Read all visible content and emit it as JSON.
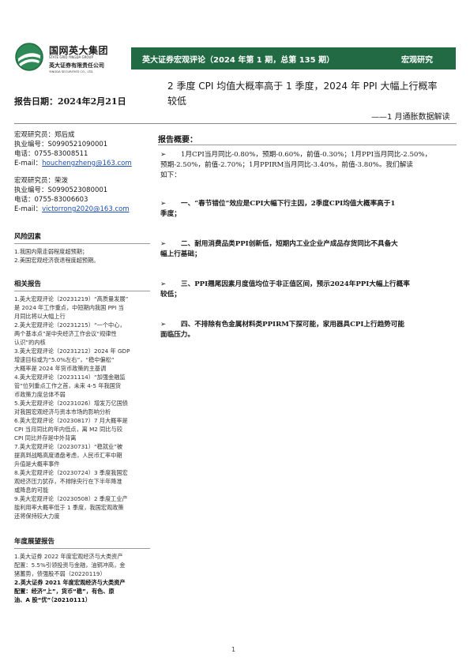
{
  "header": {
    "logo_cn": "国网英大集团",
    "logo_en": "STATE GRID YINGDA GROUP",
    "logo_sub": "英大证券有限责任公司",
    "logo_sub_en": "YINGDA SECURITIES CO., LTD.",
    "band_title": "英大证券宏观评论（2024 年第 1 期，总第 135 期）",
    "band_right": "宏观研究",
    "band_color": "#216a43"
  },
  "title": {
    "line1": "2 季度 CPI 均值大概率高于 1 季度，2024 年 PPI 大幅上行概率",
    "line2": "较低",
    "subtitle": "——1 月通胀数据解读"
  },
  "report_date": "报告日期：2024年2月21日",
  "analysts": [
    {
      "name": "宏观研究员：郑后成",
      "cert": "执业编号：S0990521090001",
      "phone": "电话：0755-83008511",
      "email_label": "E-mail：",
      "email": "houchengzheng@163.com"
    },
    {
      "name": "宏观研究员：荣泼",
      "cert": "执业编号：S0990523080001",
      "phone": "电话：0755-83006603",
      "email_label": "E-mail：",
      "email": "victorrong2020@163.com"
    }
  ],
  "risk": {
    "title": "风险因素",
    "items": [
      "1.我国内需走弱程度超预期；",
      "2.美国宏观经济衰退程度超预期。"
    ]
  },
  "related": {
    "title": "相关报告",
    "items": [
      "1.英大宏观评论（20231219）“高质量发展”",
      "是 2024 年工作重点，中短期内我国 PPI 当",
      "月同比将以大幅上行",
      "2.英大宏观评论（20231215）“一个中心，",
      "两个基本点”是中央经济工作会议“规律性",
      "认识”的内核",
      "3.英大宏观评论（20231212）2024 年 GDP",
      "增速目标或为“5.0%左右”，“稳中偏松”",
      "大概率是 2024 年货币政策的主基调",
      "4.英大宏观评论（20231114）“加强金融监",
      "管”位列重点工作之首，未来 4-5 年我国货",
      "币政策力度总体不弱",
      "5.英大宏观评论（20231026）增发万亿国债",
      "对我国宏观经济与资本市场的影响分析",
      "6.英大宏观评论（20230817）7 月大概率是",
      "CPI 当月同比的年内低点，离 M2 同比与较",
      "CPI 同比并存是中外背离",
      "7.英大宏观评论（20230731）“稳就业”被",
      "提高到战略高度通盘考虑，人民币汇率中期",
      "升值是大概率事件",
      "8.英大宏观评论（20230724）3 季度我国宏",
      "观经济压力犹存，不排除央行在下半年降准",
      "或降息的可能",
      "9.英大宏观评论（20230508）2 季度工业产",
      "能利用率大概率低于 1 季度，我国宏观政策",
      "还将保持较大力度"
    ]
  },
  "annual": {
    "title": "年度展望报告",
    "items": [
      "1.英大证券 2022 年度宏观经济与大类资产",
      "配置：5.5%引领投资与金融，油铜冲高，金",
      "猪蓄势，债强股不弱（20220119）"
    ],
    "bold_items": [
      "2.英大证券 2021 年度宏观经济与大类资产",
      "配置：经济“上”，货币“稳”，有色、原",
      "油、A 股“优”（20210111）"
    ]
  },
  "summary": {
    "title": "报告概要：",
    "bullet": "➢",
    "intro": [
      "1月CPI当月同比-0.80%，预期-0.60%，前值-0.30%；1月PPI当月同比-2.50%，",
      "预期-2.50%，前值-2.70%；1月PPIRM当月同比-3.40%，前值-3.80%。我们解读",
      "如下："
    ],
    "points": [
      [
        "一、“春节错位”效应是CPI大幅下行主因，2季度CPI均值大概率高于1",
        "季度；"
      ],
      [
        "二、耐用消费品类PPI创新低，短期内工业企业产成品存货同比不具备大",
        "幅上行基础；"
      ],
      [
        "三、PPI翘尾因素月度值均位于非正值区间，预示2024年PPI大幅上行概率",
        "较低；"
      ],
      [
        "四、不排除有色金属材料类PPIRM下探可能，家用器具CPI上行趋势可能",
        "面临压力。"
      ]
    ]
  },
  "page_number": "1"
}
